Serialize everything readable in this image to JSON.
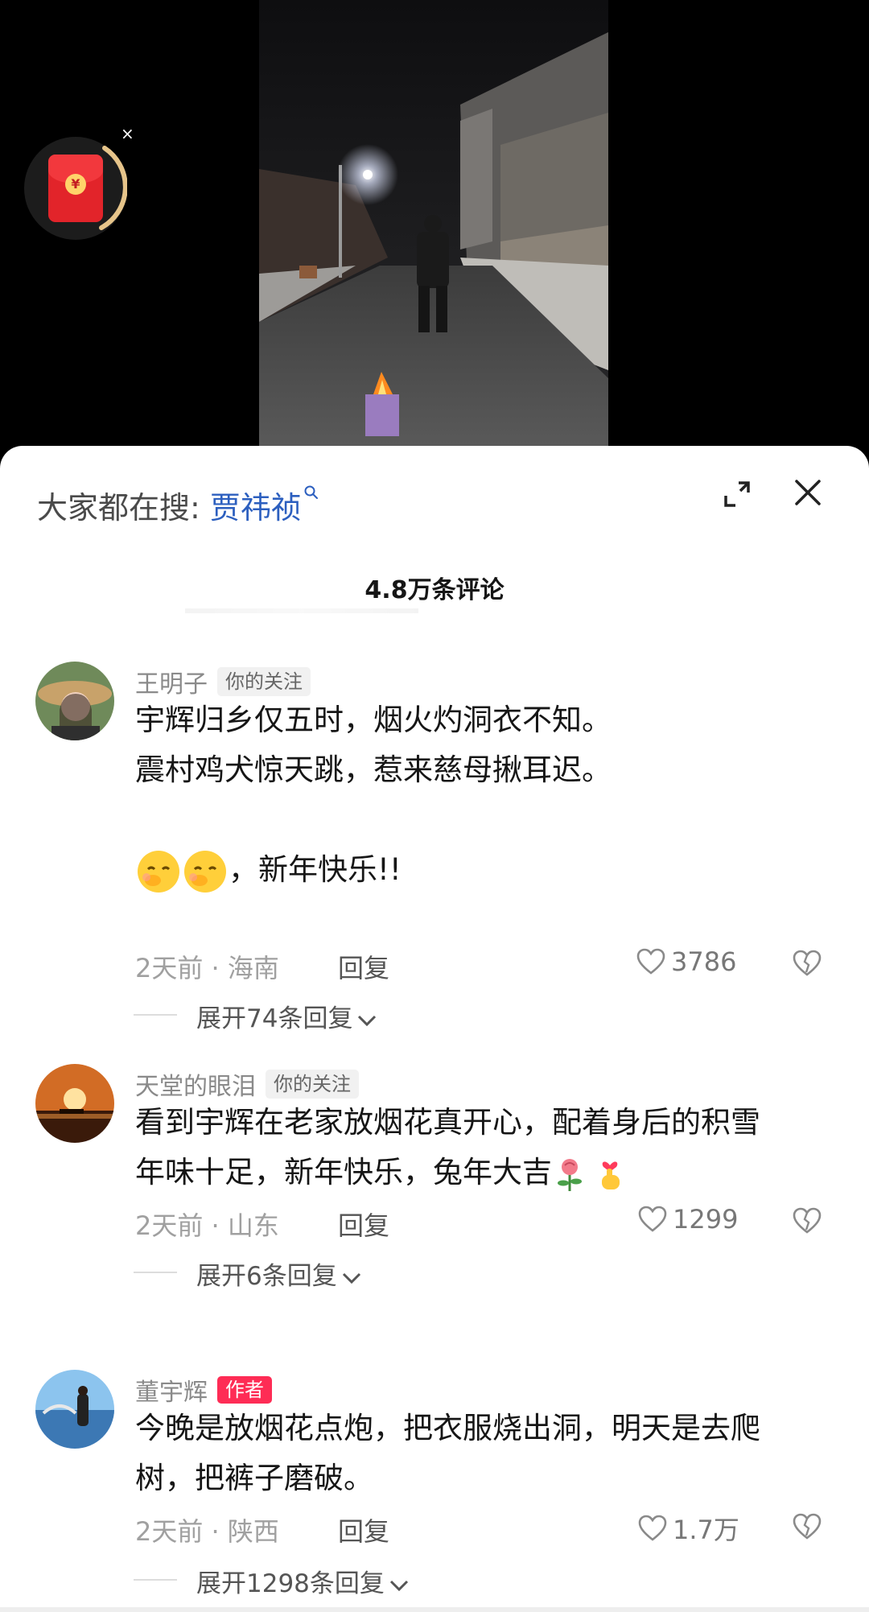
{
  "sheet": {
    "search_prefix": "大家都在搜: ",
    "search_term": "贾祎祯",
    "comment_count": "4.8万条评论"
  },
  "comments": [
    {
      "name": "王明子",
      "tag": "你的关注",
      "lines": [
        "宇辉归乡仅五时，烟火灼洞衣不知。",
        "震村鸡犬惊天跳，惹来慈母揪耳迟。",
        "，新年快乐!!"
      ],
      "time_loc": "2天前 · 海南",
      "reply": "回复",
      "likes": "3786",
      "expand": "展开74条回复"
    },
    {
      "name": "天堂的眼泪",
      "tag": "你的关注",
      "lines": [
        "看到宇辉在老家放烟花真开心，配着身后的积雪",
        "年味十足，新年快乐，兔年大吉"
      ],
      "time_loc": "2天前 · 山东",
      "reply": "回复",
      "likes": "1299",
      "expand": "展开6条回复"
    },
    {
      "name": "董宇辉",
      "tag": "作者",
      "lines": [
        "今晚是放烟花点炮，把衣服烧出洞，明天是去爬",
        "树，把裤子磨破。"
      ],
      "time_loc": "2天前 · 陕西",
      "reply": "回复",
      "likes": "1.7万",
      "expand": "展开1298条回复"
    }
  ],
  "icons": {
    "redpacket": "red-envelope-icon",
    "redpacket_coin": "¥",
    "close_small": "×"
  },
  "colors": {
    "accent": "#fe2c55",
    "link": "#2c5fbf"
  }
}
